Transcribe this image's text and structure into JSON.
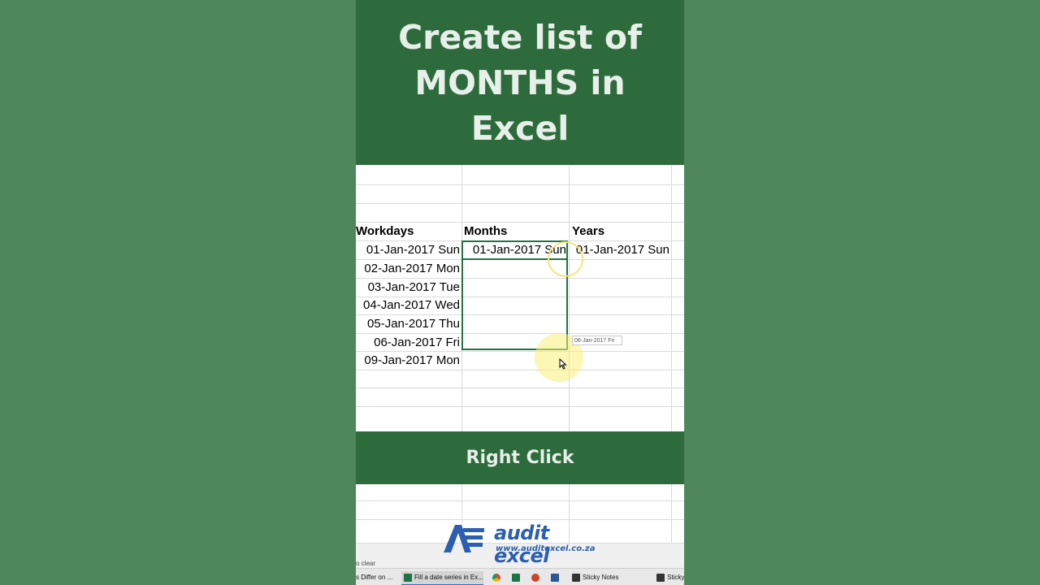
{
  "title": "Create list of MONTHS in Excel",
  "sheet": {
    "headers": [
      "Workdays",
      "Months",
      "Years"
    ],
    "workdays": [
      "01-Jan-2017 Sun",
      "02-Jan-2017 Mon",
      "03-Jan-2017 Tue",
      "04-Jan-2017 Wed",
      "05-Jan-2017 Thu",
      "06-Jan-2017 Fri",
      "09-Jan-2017 Mon"
    ],
    "months_first": "01-Jan-2017 Sun",
    "years_first": "01-Jan-2017 Sun",
    "fill_tooltip": "06-Jan-2017 Fri"
  },
  "instruction": "Right Click",
  "logo": {
    "name": "audit excel",
    "url": "www.auditexcel.co.za"
  },
  "statusbar": {
    "text": "o clear"
  },
  "taskbar": {
    "items": [
      {
        "label": "s Differ on ...",
        "icon": "window-icon"
      },
      {
        "label": "Fill a date series in Ex...",
        "icon": "excel-icon"
      },
      {
        "label": "Sticky Notes",
        "icon": "sticky-notes-icon"
      },
      {
        "label": "Sticky",
        "icon": "sticky-notes-icon"
      }
    ]
  },
  "colors": {
    "banner": "#2e6b3c",
    "background": "#4f875c",
    "selection": "#217346",
    "logo": "#2b5fb0"
  }
}
